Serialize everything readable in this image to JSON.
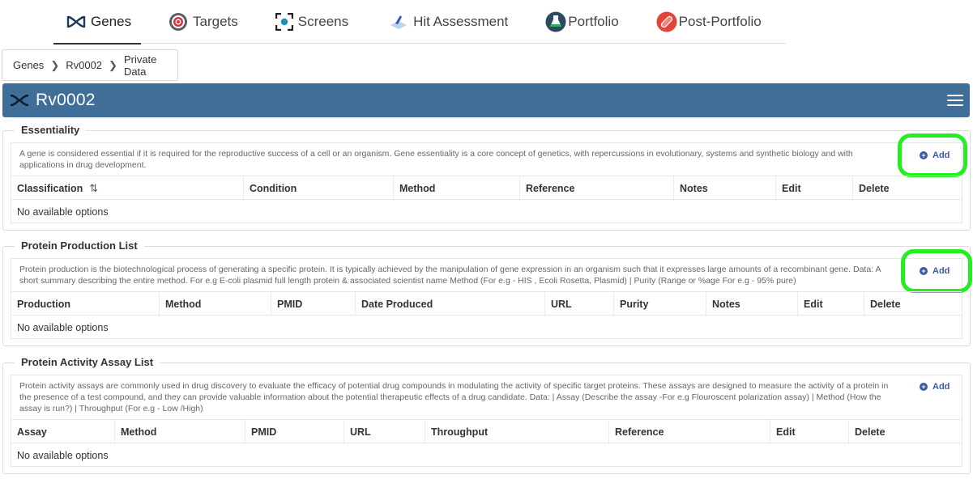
{
  "nav": {
    "tabs": [
      {
        "label": "Genes",
        "icon": "dna-icon"
      },
      {
        "label": "Targets",
        "icon": "target-icon"
      },
      {
        "label": "Screens",
        "icon": "screen-icon"
      },
      {
        "label": "Hit Assessment",
        "icon": "hit-assessment-icon"
      },
      {
        "label": "Portfolio",
        "icon": "flask-icon"
      },
      {
        "label": "Post-Portfolio",
        "icon": "pill-icon"
      }
    ],
    "active_index": 0
  },
  "breadcrumb": {
    "items": [
      "Genes",
      "Rv0002",
      "Private Data"
    ]
  },
  "header": {
    "title": "Rv0002",
    "accent": "#3f6f98"
  },
  "sections": {
    "essentiality": {
      "legend": "Essentiality",
      "description": "A gene is considered essential if it is required for the reproductive success of a cell or an organism. Gene essentiality is a core concept of genetics, with repercussions in evolutionary, systems and synthetic biology and with applications in drug development.",
      "add_label": "Add",
      "columns": [
        "Classification",
        "Condition",
        "Method",
        "Reference",
        "Notes",
        "Edit",
        "Delete"
      ],
      "empty": "No available options"
    },
    "protein_production": {
      "legend": "Protein Production List",
      "description": "Protein production is the biotechnological process of generating a specific protein. It is typically achieved by the manipulation of gene expression in an organism such that it expresses large amounts of a recombinant gene. Data: A short summary describing the entire method. For e.g E-coli plasmid full length protein & associated scientist name Method (For e.g - HIS , Ecoli Rosetta, Plasmid) | Purity (Range or %age For e.g - 95% pure)",
      "add_label": "Add",
      "columns": [
        "Production",
        "Method",
        "PMID",
        "Date Produced",
        "URL",
        "Purity",
        "Notes",
        "Edit",
        "Delete"
      ],
      "empty": "No available options"
    },
    "protein_activity": {
      "legend": "Protein Activity Assay List",
      "description": "Protein activity assays are commonly used in drug discovery to evaluate the efficacy of potential drug compounds in modulating the activity of specific target proteins. These assays are designed to measure the activity of a protein in the presence of a test compound, and they can provide valuable information about the potential therapeutic effects of a drug candidate. Data: | Assay (Describe the assay -For e.g Flouroscent polarization assay) | Method (How the assay is run?) | Throughput (For e.g - Low /High)",
      "add_label": "Add",
      "columns": [
        "Assay",
        "Method",
        "PMID",
        "URL",
        "Throughput",
        "Reference",
        "Edit",
        "Delete"
      ],
      "empty": "No available options"
    }
  },
  "highlight_color": "#22ee22"
}
